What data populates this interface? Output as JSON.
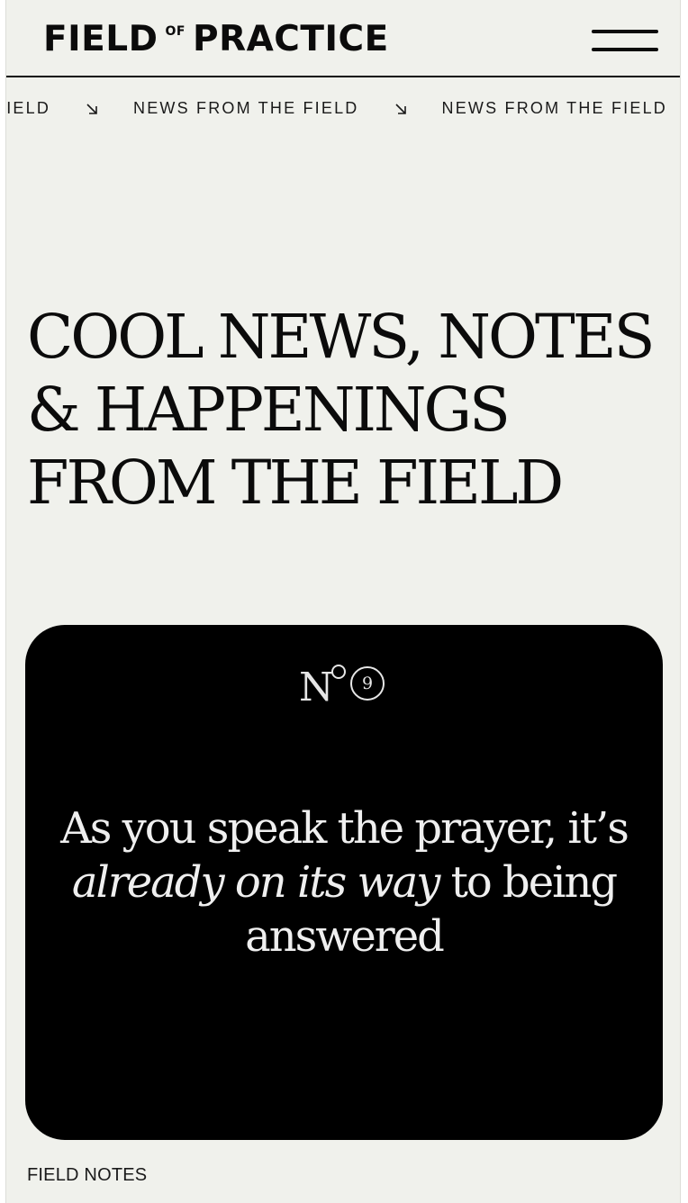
{
  "header": {
    "logo_left": "FIELD",
    "logo_of": "OF",
    "logo_right": "PRACTICE"
  },
  "ticker": {
    "items": [
      "FIELD",
      "NEWS FROM THE FIELD",
      "NEWS FROM THE FIELD"
    ],
    "arrow_icon": "arrow-down-right-icon"
  },
  "hero": {
    "line1": "COOL NEWS, NOTES",
    "line2": "& HAPPENINGS",
    "line3": "FROM THE FIELD"
  },
  "card": {
    "issue_prefix": "N",
    "issue_number": "9",
    "quote_part1": "As you speak the prayer, it’s ",
    "quote_emphasis": "already on its way",
    "quote_part2": " to being answered",
    "category": "FIELD NOTES"
  },
  "colors": {
    "background": "#f0f1ec",
    "text": "#0b0b0b",
    "card": "#000000",
    "card_text": "#efefef"
  }
}
